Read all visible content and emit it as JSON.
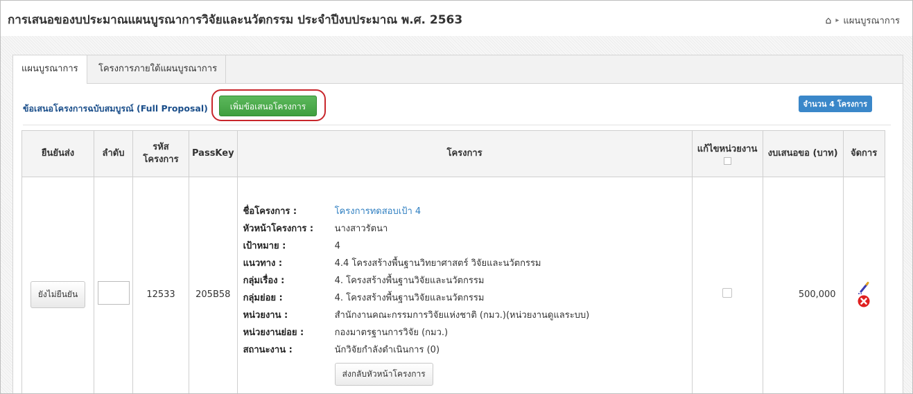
{
  "page": {
    "title": "การเสนอของบประมาณแผนบูรณาการวิจัยและนวัตกรรม ประจำปีงบประมาณ พ.ศ. 2563",
    "breadcrumb": [
      "แผนบูรณาการ"
    ]
  },
  "tabs": [
    {
      "label": "แผนบูรณาการ",
      "active": true
    },
    {
      "label": "โครงการภายใต้แผนบูรณาการ",
      "active": false
    }
  ],
  "section": {
    "heading": "ข้อเสนอโครงการฉบับสมบูรณ์ (Full Proposal)",
    "add_button": "เพิ่มข้อเสนอโครงการ",
    "count_badge": "จำนวน 4 โครงการ"
  },
  "table": {
    "headers": {
      "confirm": "ยืนยันส่ง",
      "order": "ลำดับ",
      "code": "รหัสโครงการ",
      "passkey": "PassKey",
      "project": "โครงการ",
      "edit_unit": "แก้ไขหน่วยงาน",
      "budget": "งบเสนอขอ (บาท)",
      "manage": "จัดการ"
    },
    "rows": [
      {
        "confirm_button": "ยังไม่ยืนยัน",
        "order": "",
        "code": "12533",
        "passkey": "205B58",
        "details": [
          {
            "label": "ชื่อโครงการ :",
            "value": "โครงการทดสอบเป้า 4"
          },
          {
            "label": "หัวหน้าโครงการ :",
            "value": "นางสาวรัตนา"
          },
          {
            "label": "เป้าหมาย :",
            "value": "4"
          },
          {
            "label": "แนวทาง :",
            "value": "4.4 โครงสร้างพื้นฐานวิทยาศาสตร์ วิจัยและนวัตกรรม"
          },
          {
            "label": "กลุ่มเรื่อง :",
            "value": "4. โครงสร้างพื้นฐานวิจัยและนวัตกรรม"
          },
          {
            "label": "กลุ่มย่อย :",
            "value": "4. โครงสร้างพื้นฐานวิจัยและนวัตกรรม"
          },
          {
            "label": "หน่วยงาน :",
            "value": "สำนักงานคณะกรรมการวิจัยแห่งชาติ (กมว.)(หน่วยงานดูแลระบบ)"
          },
          {
            "label": "หน่วยงานย่อย :",
            "value": "กองมาตรฐานการวิจัย (กมว.)"
          },
          {
            "label": "สถานะงาน :",
            "value": "นักวิจัยกำลังดำเนินการ (0)"
          }
        ],
        "return_button": "ส่งกลับหัวหน้าโครงการ",
        "budget": "500,000"
      }
    ]
  },
  "colors": {
    "primary_link": "#2f7fc1",
    "success": "#4cae4c",
    "badge": "#3a87c9",
    "highlight": "#c8262b",
    "danger": "#e02020"
  }
}
